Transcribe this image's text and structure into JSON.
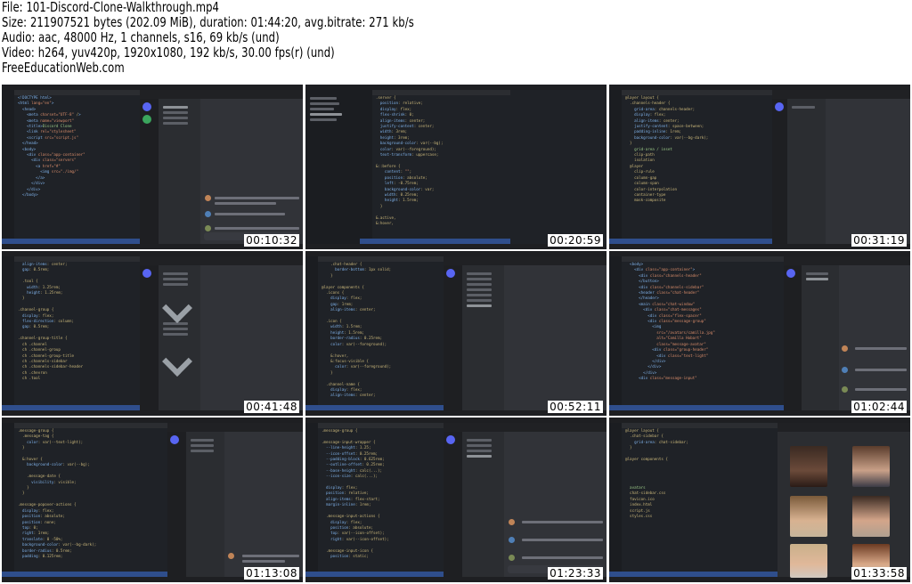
{
  "header": {
    "file": "File: 101-Discord-Clone-Walkthrough.mp4",
    "size": "Size: 211907521 bytes (202.09 MiB), duration: 01:44:20, avg.bitrate: 271 kb/s",
    "audio": "Audio: aac, 48000 Hz, 1 channels, s16, 69 kb/s (und)",
    "video": "Video: h264, yuv420p, 1920x1080, 192 kb/s, 30.00 fps(r) (und)",
    "site": "FreeEducationWeb.com"
  },
  "thumbnails": [
    {
      "timestamp": "00:10:32"
    },
    {
      "timestamp": "00:20:59"
    },
    {
      "timestamp": "00:31:19"
    },
    {
      "timestamp": "00:41:48"
    },
    {
      "timestamp": "00:52:11"
    },
    {
      "timestamp": "01:02:44"
    },
    {
      "timestamp": "01:13:08"
    },
    {
      "timestamp": "01:23:33"
    },
    {
      "timestamp": "01:33:58"
    }
  ],
  "colors": {
    "editor_bg": "#1f2227",
    "discord_bg": "#313338",
    "accent": "#5865f2"
  }
}
